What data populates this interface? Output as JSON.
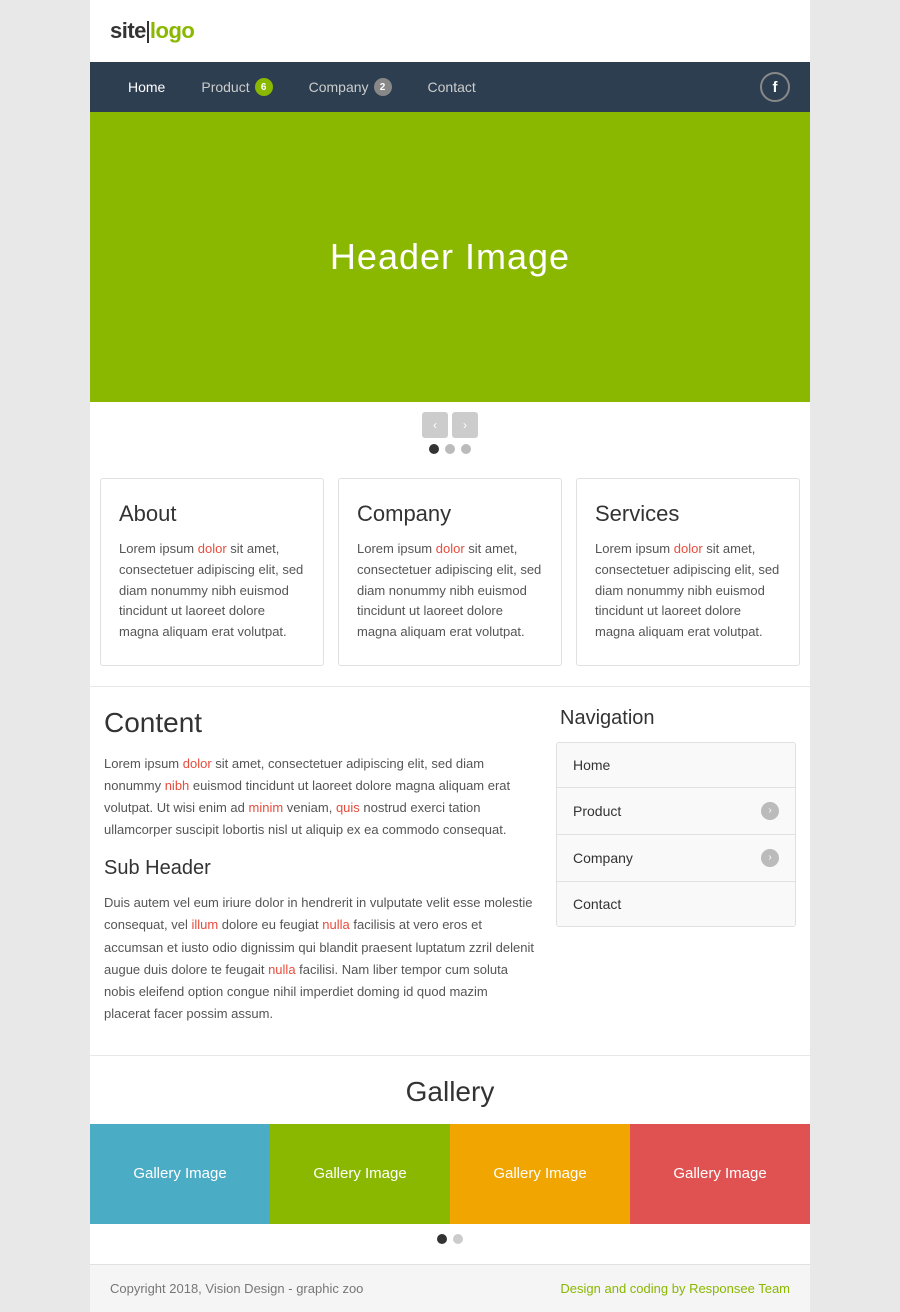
{
  "site": {
    "logo_text": "site",
    "logo_highlight": "logo",
    "tagline": ""
  },
  "nav": {
    "items": [
      {
        "label": "Home",
        "badge": null
      },
      {
        "label": "Product",
        "badge": "6"
      },
      {
        "label": "Company",
        "badge": "2",
        "badge_style": "gray"
      },
      {
        "label": "Contact",
        "badge": null
      }
    ],
    "facebook_icon": "f"
  },
  "hero": {
    "title": "Header Image",
    "bg_color": "#8ab800"
  },
  "slider": {
    "dots": [
      "active",
      "inactive",
      "inactive"
    ]
  },
  "cards": [
    {
      "title": "About",
      "text": "Lorem ipsum dolor sit amet, consectetuer adipiscing elit, sed diam nonummy nibh euismod tincidunt ut laoreet dolore magna aliquam erat volutpat."
    },
    {
      "title": "Company",
      "text": "Lorem ipsum dolor sit amet, consectetuer adipiscing elit, sed diam nonummy nibh euismod tincidunt ut laoreet dolore magna aliquam erat volutpat."
    },
    {
      "title": "Services",
      "text": "Lorem ipsum dolor sit amet, consectetuer adipiscing elit, sed diam nonummy nibh euismod tincidunt ut laoreet dolore magna aliquam erat volutpat."
    }
  ],
  "content": {
    "title": "Content",
    "text": "Lorem ipsum dolor sit amet, consectetuer adipiscing elit, sed diam nonummy nibh euismod tincidunt ut laoreet dolore magna aliquam erat volutpat. Ut wisi enim ad minim veniam, quis nostrud exerci tation ullamcorper suscipit lobortis nisl ut aliquip ex ea commodo consequat.",
    "subheader": {
      "title": "Sub Header",
      "text": "Duis autem vel eum iriure dolor in hendrerit in vulputate velit esse molestie consequat, vel illum dolore eu feugiat nulla facilisis at vero eros et accumsan et iusto odio dignissim qui blandit praesent luptatum zzril delenit augue duis dolore te feugait nulla facilisi. Nam liber tempor cum soluta nobis eleifend option congue nihil imperdiet doming id quod mazim placerat facer possim assum."
    }
  },
  "sidebar_nav": {
    "title": "Navigation",
    "items": [
      {
        "label": "Home",
        "has_chevron": false
      },
      {
        "label": "Product",
        "has_chevron": true
      },
      {
        "label": "Company",
        "has_chevron": true
      },
      {
        "label": "Contact",
        "has_chevron": false
      }
    ]
  },
  "gallery": {
    "title": "Gallery",
    "items": [
      {
        "label": "Gallery Image",
        "color": "#4bacc6"
      },
      {
        "label": "Gallery Image",
        "color": "#8ab800"
      },
      {
        "label": "Gallery Image",
        "color": "#f0a500"
      },
      {
        "label": "Gallery Image",
        "color": "#e05252"
      }
    ],
    "dots": [
      "active",
      "inactive"
    ]
  },
  "footer": {
    "left": "Copyright 2018, Vision Design - graphic zoo",
    "right": "Design and coding by Responsee Team"
  }
}
